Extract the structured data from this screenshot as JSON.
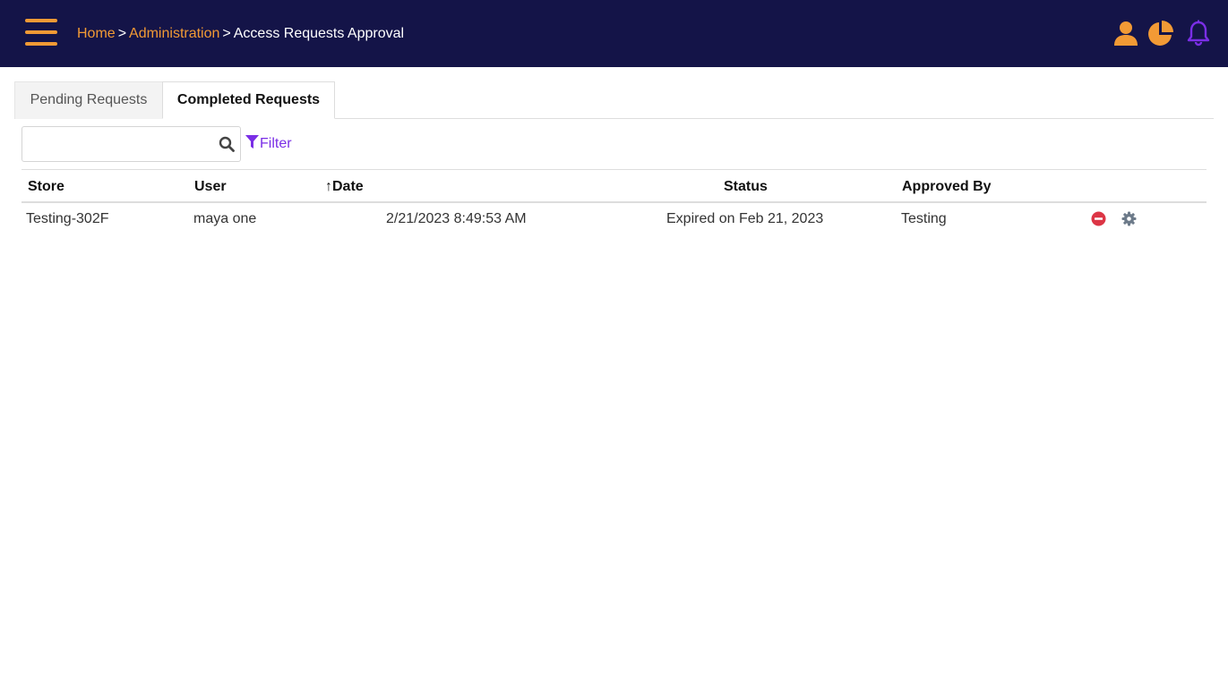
{
  "header": {
    "breadcrumb": {
      "home": "Home",
      "sep1": ">",
      "admin": "Administration",
      "sep2": ">",
      "current": "Access Requests Approval"
    },
    "icons": [
      "menu-icon",
      "user-icon",
      "pie-chart-icon",
      "bell-icon"
    ],
    "colors": {
      "bar": "#141448",
      "accent": "#f29a35",
      "bell": "#7a2ee6"
    }
  },
  "tabs": [
    {
      "label": "Pending Requests",
      "active": false
    },
    {
      "label": "Completed Requests",
      "active": true
    }
  ],
  "search": {
    "value": "",
    "placeholder": ""
  },
  "filter": {
    "label": "Filter"
  },
  "table": {
    "columns": {
      "store": "Store",
      "user": "User",
      "date_arrow": "↑",
      "date": "Date",
      "status": "Status",
      "approved_by": "Approved By"
    },
    "rows": [
      {
        "store": "Testing-302F",
        "user": "maya one",
        "date": "2/21/2023 8:49:53 AM",
        "status": "Expired on Feb 21, 2023",
        "approved_by": "Testing",
        "actions": [
          "revoke-icon",
          "settings-icon"
        ]
      }
    ]
  }
}
